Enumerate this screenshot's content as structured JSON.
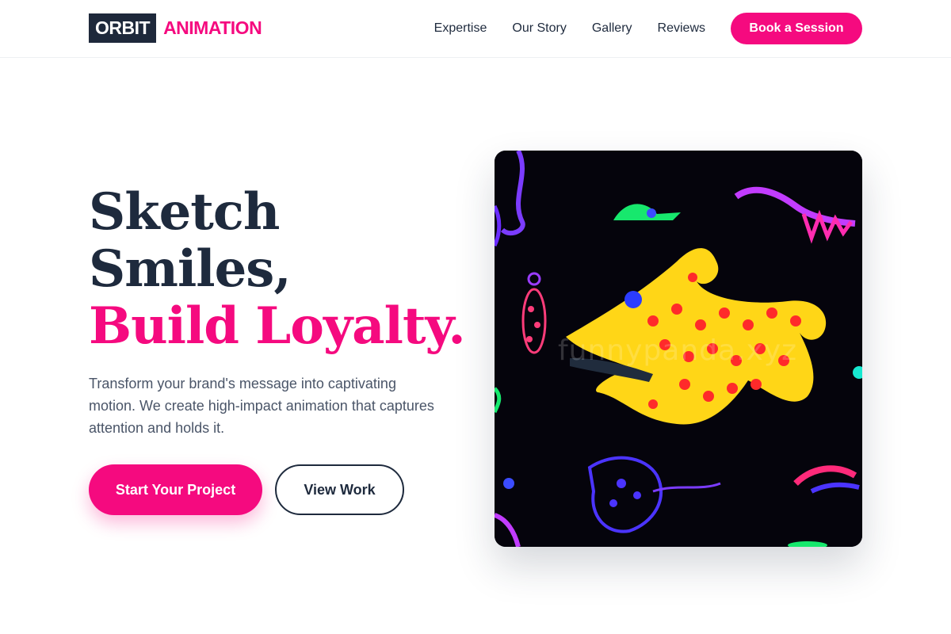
{
  "brand": {
    "name_primary": "ORBIT",
    "name_accent": "ANIMATION"
  },
  "nav": {
    "links": [
      {
        "label": "Expertise"
      },
      {
        "label": "Our Story"
      },
      {
        "label": "Gallery"
      },
      {
        "label": "Reviews"
      }
    ],
    "cta_label": "Book a Session"
  },
  "hero": {
    "title_line1": "Sketch",
    "title_line2": "Smiles,",
    "title_line3": "Build Loyalty.",
    "subtitle": "Transform your brand's message into captivating motion. We create high-impact animation that captures attention and holds it.",
    "primary_button": "Start Your Project",
    "secondary_button": "View Work",
    "image_watermark": "funnypanda.xyz"
  },
  "colors": {
    "accent": "#f50a7f",
    "navy": "#1e293b",
    "text": "#1e2a3d",
    "muted": "#4a5568"
  }
}
